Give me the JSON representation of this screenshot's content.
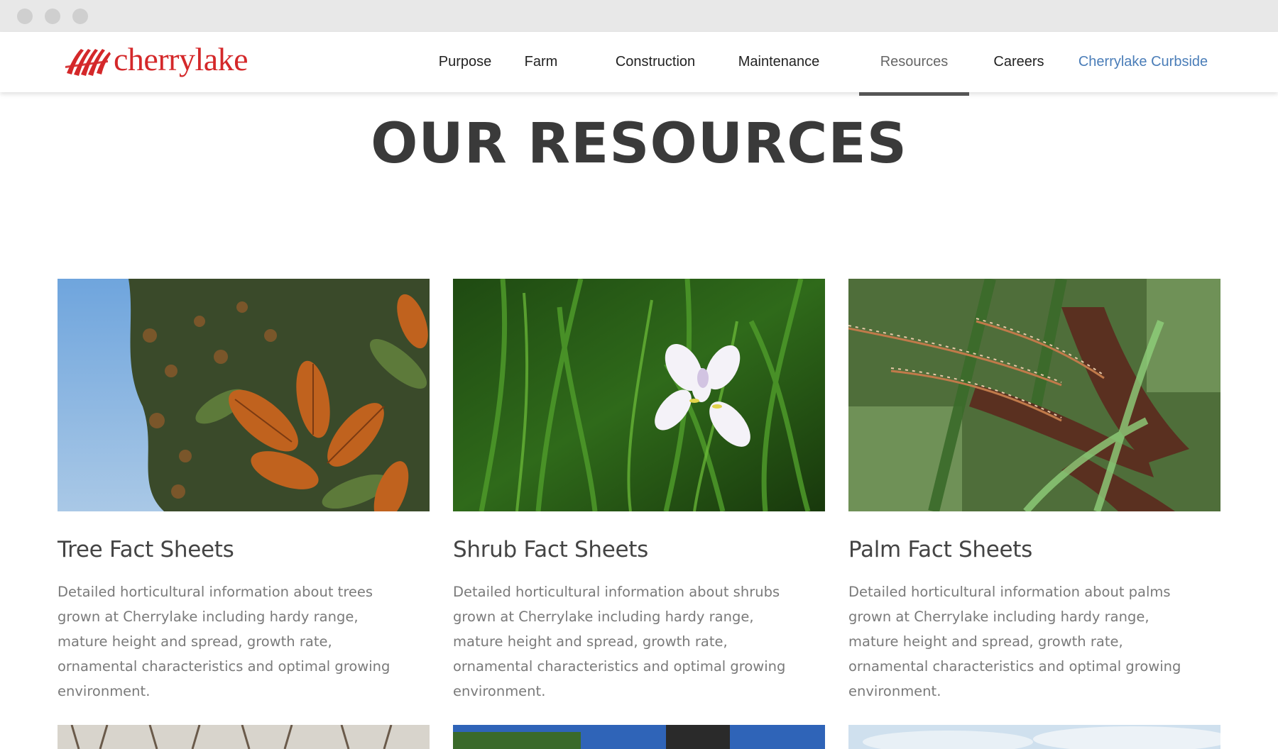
{
  "brand": {
    "name": "cherrylake",
    "color": "#d4282a"
  },
  "nav": {
    "items": [
      {
        "label": "Purpose"
      },
      {
        "label": "Farm"
      },
      {
        "label": "Construction"
      },
      {
        "label": "Maintenance"
      },
      {
        "label": "Resources",
        "active": true
      },
      {
        "label": "Careers"
      },
      {
        "label": "Cherrylake Curbside",
        "color": "#4a7db8"
      }
    ]
  },
  "page": {
    "title": "OUR RESOURCES"
  },
  "cards": [
    {
      "title": "Tree Fact Sheets",
      "description": "Detailed horticultural information about trees grown at Cherrylake including hardy range, mature height and spread, growth rate, ornamental characteristics and optimal growing environment."
    },
    {
      "title": "Shrub Fact Sheets",
      "description": "Detailed horticultural information about shrubs grown at Cherrylake including hardy range, mature height and spread, growth rate, ornamental characteristics and optimal growing environment."
    },
    {
      "title": "Palm Fact Sheets",
      "description": "Detailed horticultural information about palms grown at Cherrylake including hardy range, mature height and spread, growth rate, ornamental characteristics and optimal growing environment."
    }
  ]
}
